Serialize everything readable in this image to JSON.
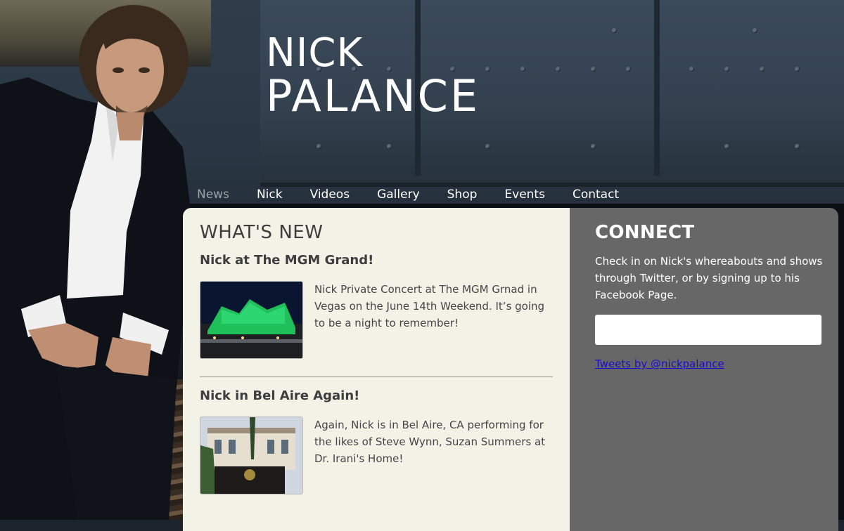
{
  "site": {
    "title_line1": "NICK",
    "title_line2": "PALANCE"
  },
  "nav": {
    "items": [
      {
        "label": "News",
        "active": true
      },
      {
        "label": "Nick"
      },
      {
        "label": "Videos"
      },
      {
        "label": "Gallery"
      },
      {
        "label": "Shop"
      },
      {
        "label": "Events"
      },
      {
        "label": "Contact"
      }
    ]
  },
  "main": {
    "heading": "WHAT'S NEW",
    "posts": [
      {
        "title": "Nick at The MGM Grand!",
        "text": "Nick Private Concert at The MGM Grnad in Vegas on the June 14th Weekend. It’s going to be a night to remember!",
        "image": "mgm-grand-photo"
      },
      {
        "title": "Nick in Bel Aire Again!",
        "text": "Again, Nick is in Bel Aire, CA performing for the likes of Steve Wynn, Suzan Summers at Dr. Irani's Home!",
        "image": "bel-aire-mansion-photo"
      }
    ]
  },
  "sidebar": {
    "heading": "CONNECT",
    "text": "Check in on Nick's whereabouts and shows through Twitter, or by signing up to his Facebook Page.",
    "twitter_link": "Tweets by @nickpalance"
  },
  "colors": {
    "main_bg": "#f3f2e7",
    "sidebar_bg": "#676767",
    "nav_active": "#9aa3aa",
    "link": "#1a0dcc"
  }
}
